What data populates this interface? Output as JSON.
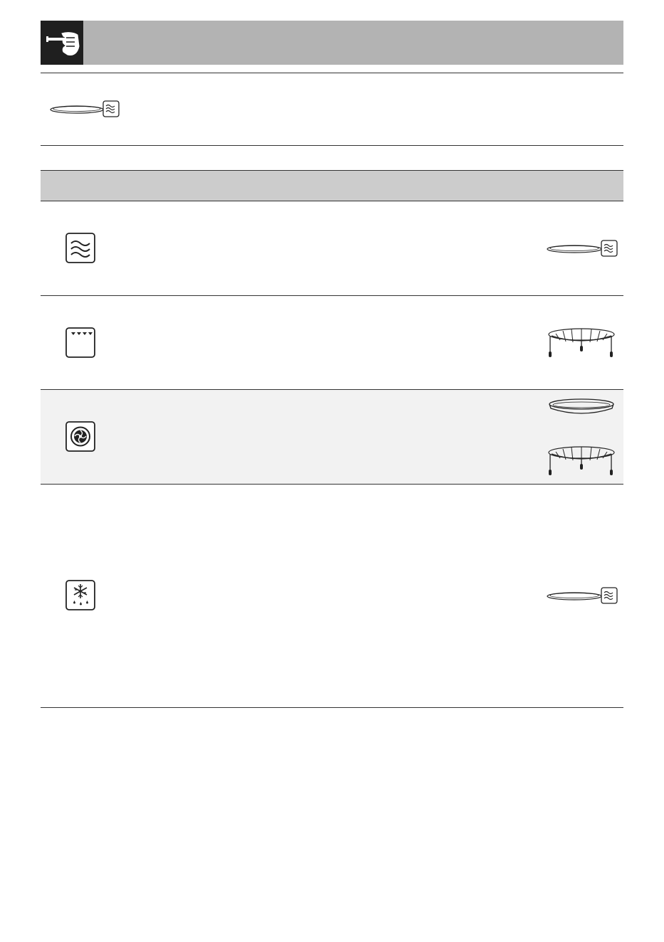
{
  "header": {
    "icon": "pointing-hand-icon",
    "title": ""
  },
  "intro": {
    "icon": "glass-turntable-icon",
    "text": ""
  },
  "table": {
    "headers": [],
    "rows": [
      {
        "function_icon": "microwave-waves-icon",
        "accessory_icons": [
          "glass-turntable-icon"
        ]
      },
      {
        "function_icon": "top-grill-icon",
        "accessory_icons": [
          "grill-rack-icon"
        ]
      },
      {
        "function_icon": "fan-convection-icon",
        "accessory_icons": [
          "baking-tray-icon",
          "grill-rack-icon"
        ]
      },
      {
        "function_icon": "defrost-snowflake-icon",
        "accessory_icons": [
          "glass-turntable-icon"
        ]
      }
    ]
  },
  "colors": {
    "header_band": "#b3b3b3",
    "header_icon_bg": "#1f1f1f",
    "table_header_bg": "#cccccc",
    "shaded_row_bg": "#f2f2f2",
    "rule": "#333333"
  }
}
